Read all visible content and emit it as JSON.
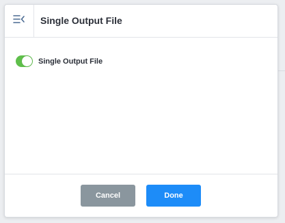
{
  "dialog": {
    "title": "Single Output File",
    "menu_icon": "collapse-menu-icon"
  },
  "settings": {
    "single_output_file": {
      "label": "Single Output File",
      "enabled": true
    }
  },
  "footer": {
    "cancel_label": "Cancel",
    "done_label": "Done"
  },
  "colors": {
    "toggle_on": "#5fbf4b",
    "cancel_button": "#8a969e",
    "done_button": "#1d8cf8"
  }
}
